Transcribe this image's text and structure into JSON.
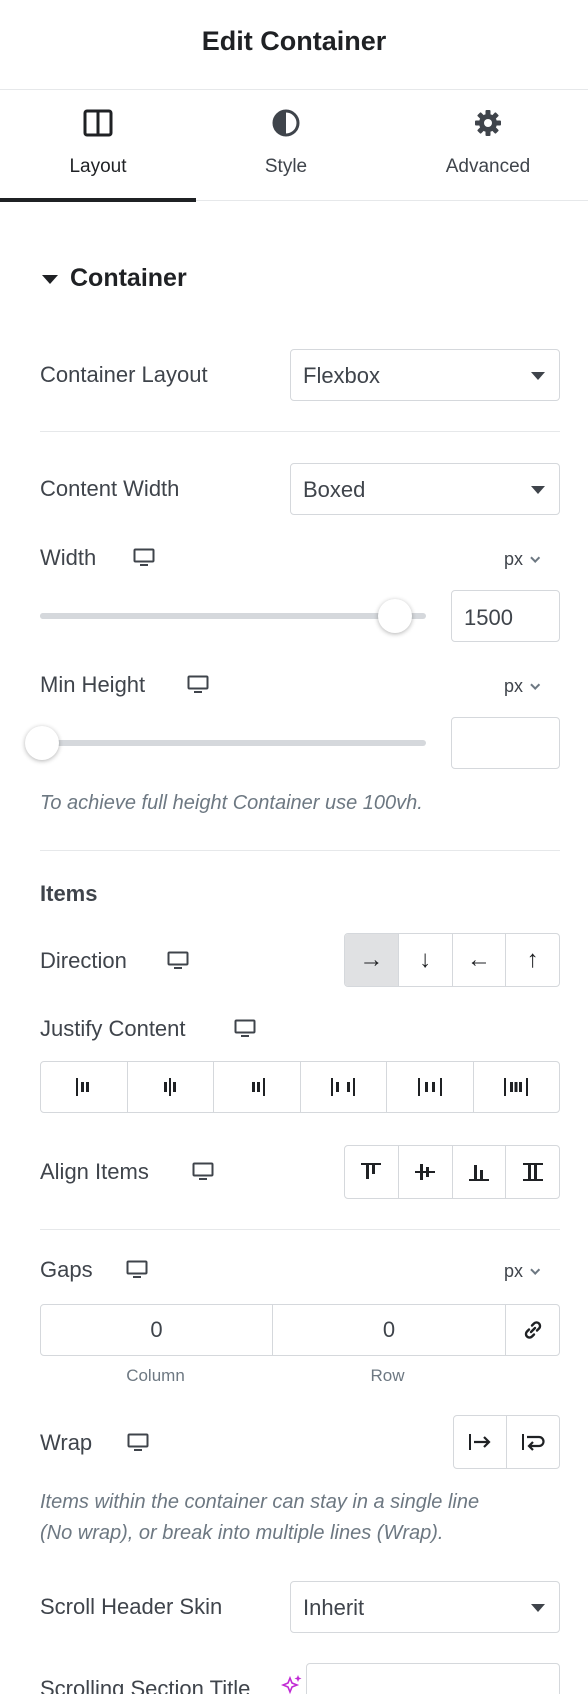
{
  "header": {
    "title": "Edit Container"
  },
  "tabs": [
    {
      "label": "Layout",
      "icon": "layout-columns-icon",
      "active": true
    },
    {
      "label": "Style",
      "icon": "contrast-icon",
      "active": false
    },
    {
      "label": "Advanced",
      "icon": "gear-icon",
      "active": false
    }
  ],
  "section": {
    "title": "Container",
    "icon": "caret-down-icon"
  },
  "container_layout": {
    "label": "Container Layout",
    "value": "Flexbox"
  },
  "content_width": {
    "label": "Content Width",
    "value": "Boxed"
  },
  "width": {
    "label": "Width",
    "unit": "px",
    "value": "1500",
    "slider_fraction": 0.92
  },
  "min_height": {
    "label": "Min Height",
    "unit": "px",
    "value": "",
    "slider_fraction": 0.0,
    "hint": "To achieve full height Container use 100vh."
  },
  "items": {
    "heading": "Items",
    "direction": {
      "label": "Direction",
      "options": [
        "→",
        "↓",
        "←",
        "↑"
      ],
      "selected": 0
    },
    "justify_content": {
      "label": "Justify Content"
    },
    "align_items": {
      "label": "Align Items"
    }
  },
  "gaps": {
    "label": "Gaps",
    "unit": "px",
    "column": {
      "value": "0",
      "label": "Column"
    },
    "row": {
      "value": "0",
      "label": "Row"
    },
    "link_icon": "link-icon"
  },
  "wrap": {
    "label": "Wrap",
    "hint_line1": "Items within the container can stay in a single line",
    "hint_line2": "(No wrap), or break into multiple lines (Wrap)."
  },
  "scroll_header_skin": {
    "label": "Scroll Header Skin",
    "value": "Inherit"
  },
  "scrolling_section_title": {
    "label": "Scrolling Section Title",
    "icon": "sparkle-icon"
  },
  "colors": {
    "accent": "#1f2124",
    "text": "#3f444b",
    "muted": "#6d7882",
    "border": "#d5d8dc",
    "selected_bg": "#e0e1e3",
    "sparkle": "#c12ad4"
  }
}
